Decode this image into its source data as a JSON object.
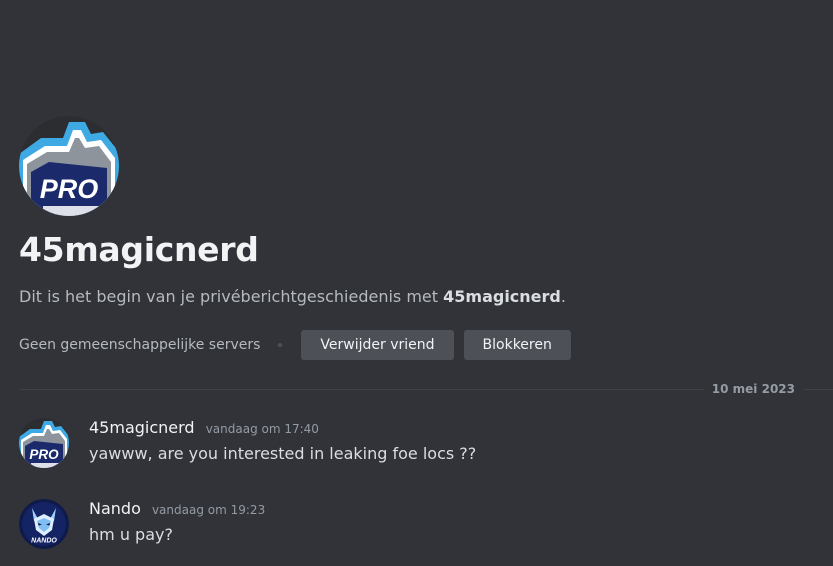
{
  "welcome": {
    "username": "45magicnerd",
    "avatar_badge": "PRO",
    "description_prefix": "Dit is het begin van je privéberichtgeschiedenis met ",
    "description_username": "45magicnerd",
    "description_suffix": ".",
    "mutual_servers": "Geen gemeenschappelijke servers",
    "remove_friend_label": "Verwijder vriend",
    "block_label": "Blokkeren"
  },
  "divider": {
    "date": "10 mei 2023"
  },
  "messages": [
    {
      "author": "45magicnerd",
      "avatar_badge": "PRO",
      "timestamp": "vandaag om 17:40",
      "text": "yawww, are you interested in leaking foe locs ??"
    },
    {
      "author": "Nando",
      "avatar_badge": "NANDO",
      "timestamp": "vandaag om 19:23",
      "text": "hm u pay?"
    }
  ],
  "colors": {
    "background": "#313338",
    "button": "#4e5058",
    "heading": "#f2f3f5",
    "muted": "#b5bac1",
    "timestamp": "#949ba4",
    "avatar_navy": "#1b2a6b",
    "avatar_blue": "#3fa9e3"
  },
  "icons": {
    "pro_avatar": "pro-logo-avatar-icon",
    "nando_avatar": "nando-wolf-avatar-icon"
  }
}
